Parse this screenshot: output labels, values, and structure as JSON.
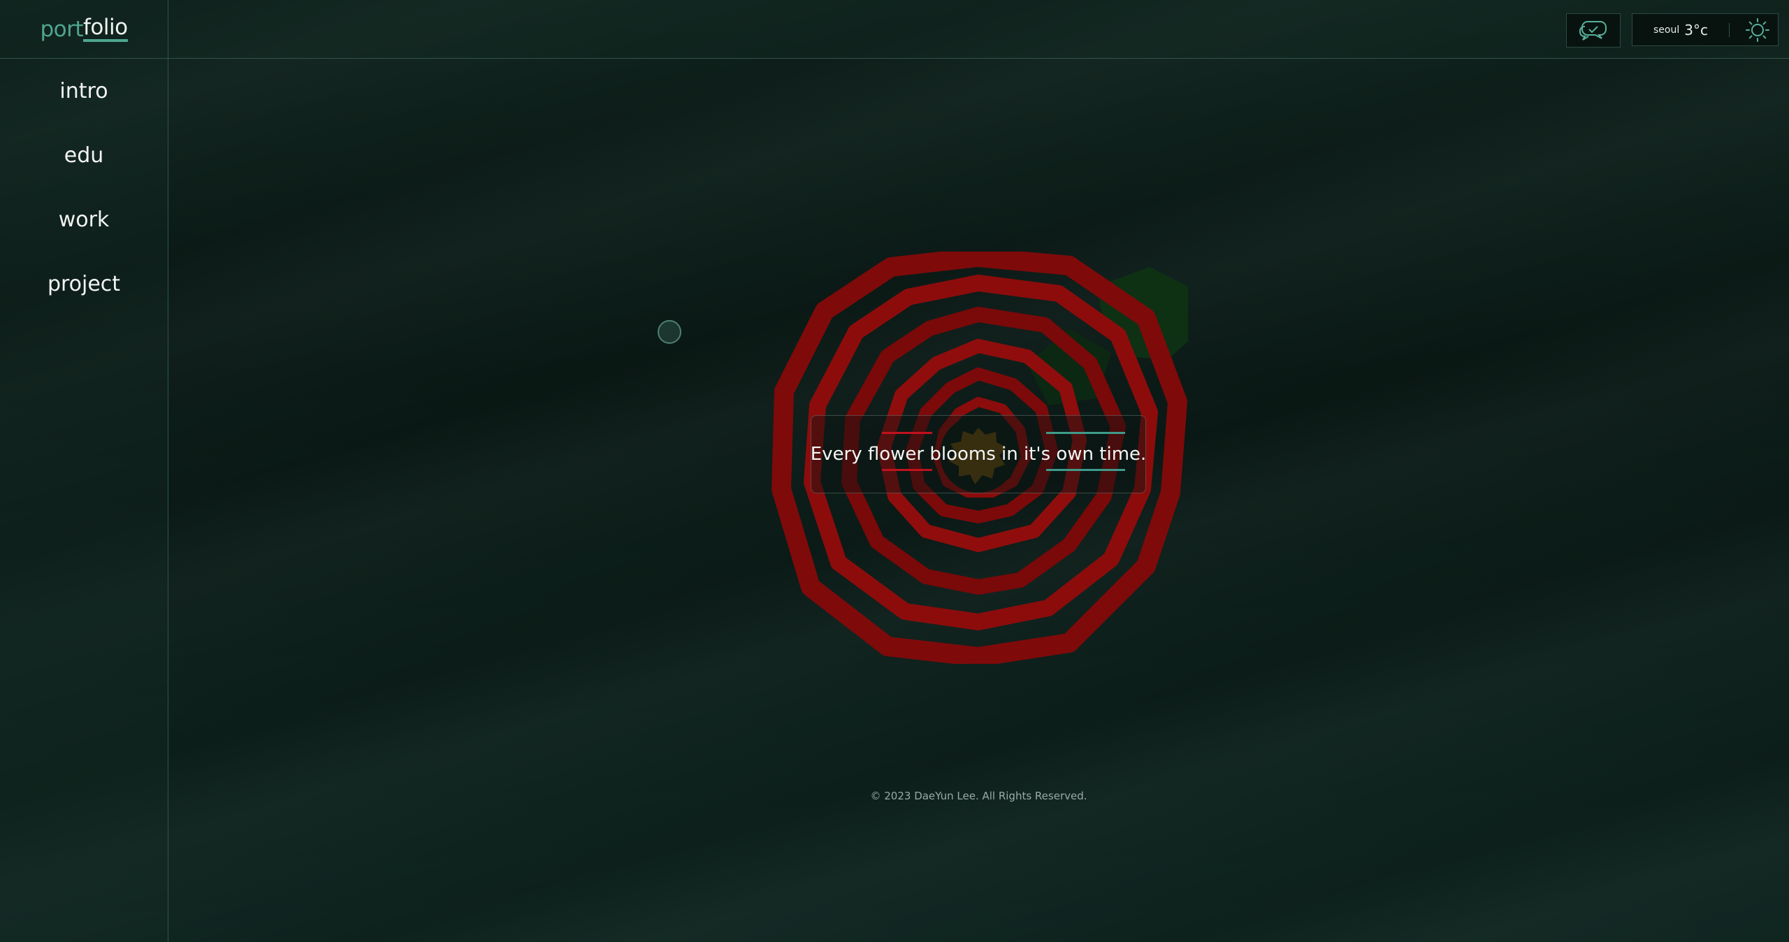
{
  "logo": {
    "part1": "port",
    "part2": "folio"
  },
  "nav": [
    {
      "label": "intro"
    },
    {
      "label": "edu"
    },
    {
      "label": "work"
    },
    {
      "label": "project"
    }
  ],
  "header": {
    "chat_icon": "chat-bubbles-icon",
    "weather": {
      "city": "seoul",
      "temperature": "3°c",
      "theme_icon": "sun-icon"
    }
  },
  "hero": {
    "quote": "Every flower blooms in it's own time."
  },
  "footer": {
    "copyright": "© 2023 DaeYun Lee. All Rights Reserved."
  },
  "colors": {
    "accent": "#4fa68e",
    "rose": "#8a0a0a",
    "quote_red": "#c0121e",
    "quote_teal": "#3f9b8a",
    "background": "#0c1c18"
  }
}
